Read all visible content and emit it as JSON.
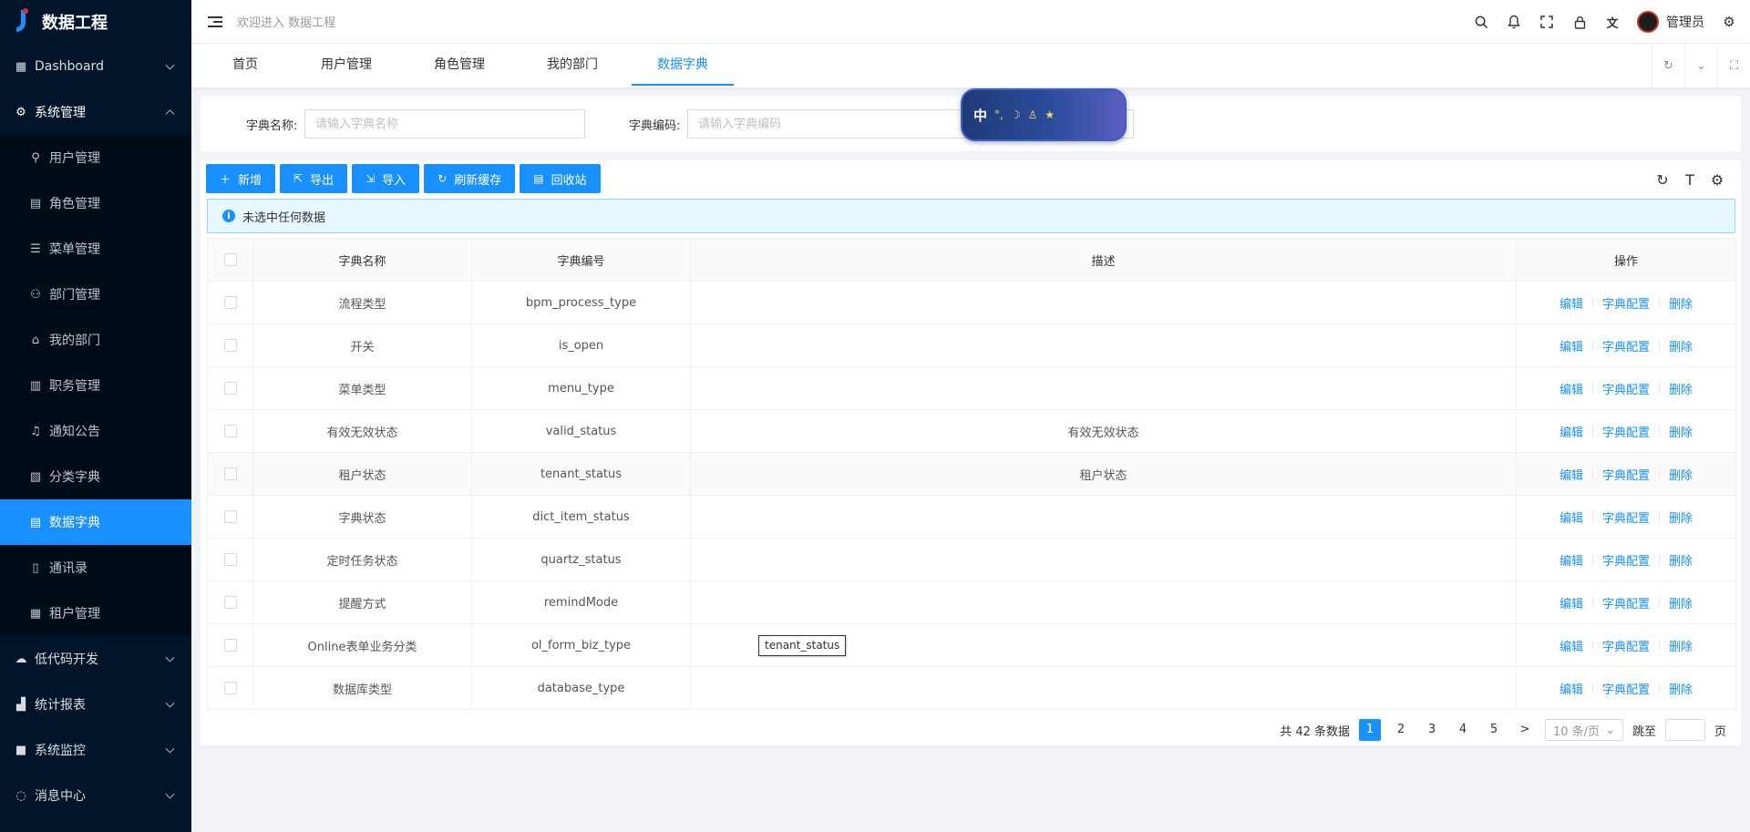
{
  "app": {
    "title": "数据工程"
  },
  "sidebar": {
    "items": [
      {
        "label": "Dashboard",
        "icon": "grid-icon",
        "expanded": false
      },
      {
        "label": "系统管理",
        "icon": "gear-icon",
        "expanded": true,
        "children": [
          {
            "label": "用户管理",
            "icon": "user-icon"
          },
          {
            "label": "角色管理",
            "icon": "role-icon"
          },
          {
            "label": "菜单管理",
            "icon": "menu-list-icon"
          },
          {
            "label": "部门管理",
            "icon": "team-icon"
          },
          {
            "label": "我的部门",
            "icon": "home-icon"
          },
          {
            "label": "职务管理",
            "icon": "post-icon"
          },
          {
            "label": "通知公告",
            "icon": "bell-icon"
          },
          {
            "label": "分类字典",
            "icon": "category-icon"
          },
          {
            "label": "数据字典",
            "icon": "dict-icon",
            "active": true
          },
          {
            "label": "通讯录",
            "icon": "contacts-icon"
          },
          {
            "label": "租户管理",
            "icon": "tenant-icon"
          }
        ]
      },
      {
        "label": "低代码开发",
        "icon": "cloud-icon",
        "expanded": false
      },
      {
        "label": "统计报表",
        "icon": "chart-icon",
        "expanded": false
      },
      {
        "label": "系统监控",
        "icon": "camera-icon",
        "expanded": false
      },
      {
        "label": "消息中心",
        "icon": "message-icon",
        "expanded": false
      }
    ]
  },
  "header": {
    "breadcrumb": "欢迎进入 数据工程",
    "icons": [
      "search-icon",
      "bell-icon",
      "fullscreen-icon",
      "lock-icon",
      "translate-icon"
    ],
    "user": "管理员"
  },
  "tabs": [
    {
      "label": "首页"
    },
    {
      "label": "用户管理"
    },
    {
      "label": "角色管理"
    },
    {
      "label": "我的部门"
    },
    {
      "label": "数据字典",
      "active": true
    }
  ],
  "search": {
    "name_label": "字典名称:",
    "name_placeholder": "请输入字典名称",
    "code_label": "字典编码:",
    "code_placeholder": "请输入字典编码"
  },
  "ime_widget": {
    "char": "中"
  },
  "toolbar": {
    "buttons": [
      {
        "label": "新增",
        "icon": "plus-icon"
      },
      {
        "label": "导出",
        "icon": "export-icon"
      },
      {
        "label": "导入",
        "icon": "import-icon"
      },
      {
        "label": "刷新缓存",
        "icon": "sync-icon"
      },
      {
        "label": "回收站",
        "icon": "recycle-icon"
      }
    ]
  },
  "alert": {
    "text": "未选中任何数据"
  },
  "table": {
    "columns": [
      "字典名称",
      "字典编号",
      "描述",
      "操作"
    ],
    "actions": [
      "编辑",
      "字典配置",
      "删除"
    ],
    "rows": [
      {
        "name": "流程类型",
        "code": "bpm_process_type",
        "desc": ""
      },
      {
        "name": "开关",
        "code": "is_open",
        "desc": ""
      },
      {
        "name": "菜单类型",
        "code": "menu_type",
        "desc": ""
      },
      {
        "name": "有效无效状态",
        "code": "valid_status",
        "desc": "有效无效状态"
      },
      {
        "name": "租户状态",
        "code": "tenant_status",
        "desc": "租户状态"
      },
      {
        "name": "字典状态",
        "code": "dict_item_status",
        "desc": ""
      },
      {
        "name": "定时任务状态",
        "code": "quartz_status",
        "desc": ""
      },
      {
        "name": "提醒方式",
        "code": "remindMode",
        "desc": ""
      },
      {
        "name": "Online表单业务分类",
        "code": "ol_form_biz_type",
        "desc": ""
      },
      {
        "name": "数据库类型",
        "code": "database_type",
        "desc": ""
      }
    ],
    "tooltip": "tenant_status"
  },
  "pagination": {
    "total": "共 42 条数据",
    "pages": [
      "1",
      "2",
      "3",
      "4",
      "5"
    ],
    "current": "1",
    "page_size": "10 条/页",
    "jump_label": "跳至",
    "page_suffix": "页"
  },
  "colors": {
    "primary": "#1890ff",
    "sidebar_bg": "#001529",
    "submenu_bg": "#000c17"
  }
}
